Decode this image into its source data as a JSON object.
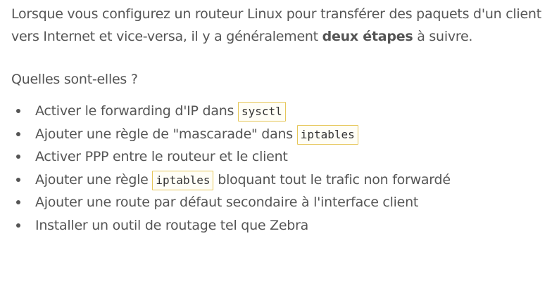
{
  "intro": {
    "text_before": "Lorsque vous configurez un routeur Linux pour transférer des paquets d'un client vers Internet et vice-versa, il y a généralement ",
    "bold": "deux étapes",
    "text_after": " à suivre."
  },
  "question": "Quelles sont-elles ?",
  "options": [
    {
      "before": "Activer le forwarding d'IP dans ",
      "code": "sysctl",
      "after": ""
    },
    {
      "before": "Ajouter une règle de \"mascarade\" dans ",
      "code": "iptables",
      "after": ""
    },
    {
      "before": "Activer PPP entre le routeur et le client",
      "code": "",
      "after": ""
    },
    {
      "before": "Ajouter une règle ",
      "code": "iptables",
      "after": " bloquant tout le trafic non forwardé"
    },
    {
      "before": "Ajouter une route par défaut secondaire à l'interface client",
      "code": "",
      "after": ""
    },
    {
      "before": "Installer un outil de routage tel que Zebra",
      "code": "",
      "after": ""
    }
  ],
  "colors": {
    "text": "#555555",
    "code_border": "#e6c75a"
  }
}
